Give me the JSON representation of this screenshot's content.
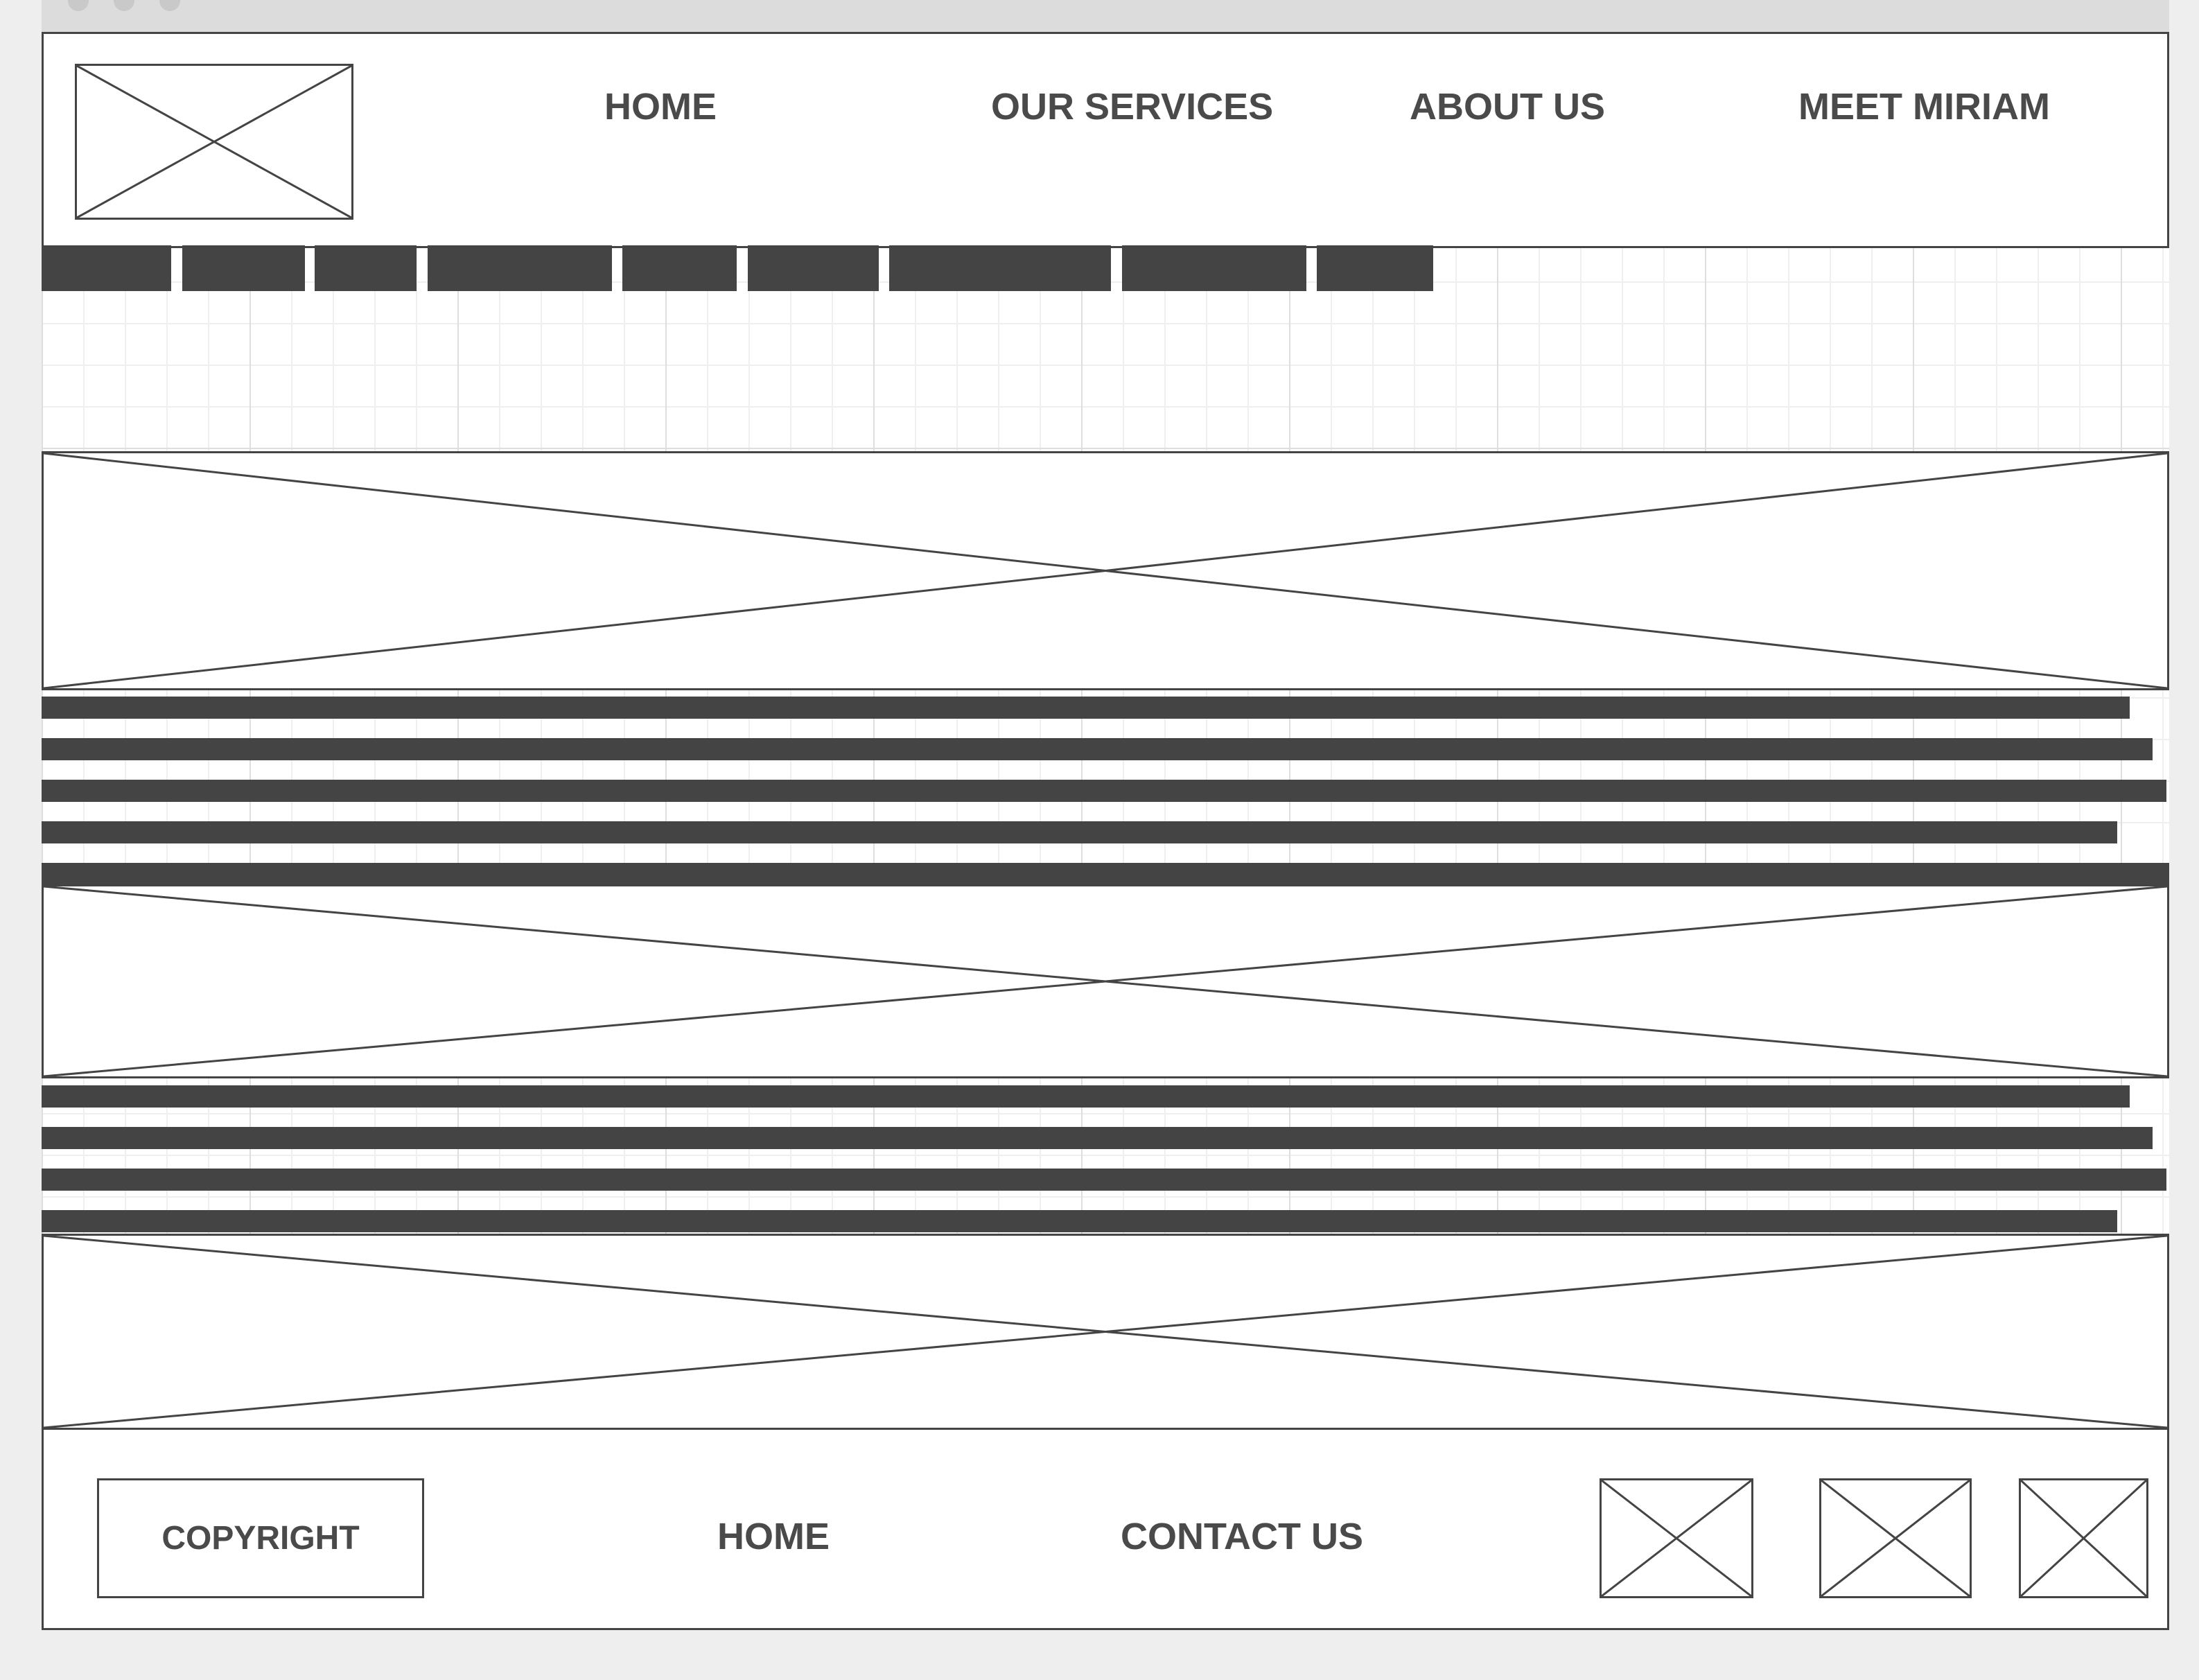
{
  "header": {
    "logo_icon": "image-placeholder-icon",
    "nav": {
      "home": "HOME",
      "services": "OUR SERVICES",
      "about": "ABOUT US",
      "miriam": "MEET MIRIAM"
    }
  },
  "sub_nav": {
    "tab_count": 9
  },
  "content": {
    "image_icon": "image-placeholder-icon",
    "text_block_1_lines": 5,
    "text_block_2_lines": 4
  },
  "footer": {
    "copyright": "COPYRIGHT",
    "home": "HOME",
    "contact": "CONTACT US",
    "social_icons": [
      "image-placeholder-icon",
      "image-placeholder-icon",
      "image-placeholder-icon"
    ]
  },
  "colors": {
    "ink": "#444444",
    "text": "#4a4a4a",
    "grid": "#dedede",
    "background": "#eeeeee"
  }
}
